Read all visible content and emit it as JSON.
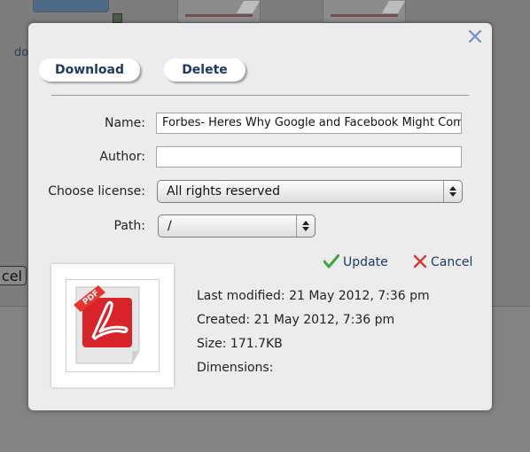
{
  "background": {
    "partial_text": "do",
    "partial_button": "cel"
  },
  "dialog": {
    "buttons": {
      "download": "Download",
      "delete": "Delete"
    },
    "form": {
      "name_label": "Name:",
      "name_value": "Forbes- Heres Why Google and Facebook Might Comp",
      "author_label": "Author:",
      "author_value": "",
      "license_label": "Choose license:",
      "license_value": "All rights reserved",
      "path_label": "Path:",
      "path_value": "/"
    },
    "actions": {
      "update": "Update",
      "cancel": "Cancel"
    },
    "file_icon_badge": "PDF",
    "meta": {
      "last_modified": "Last modified: 21 May 2012, 7:36 pm",
      "created": "Created: 21 May 2012, 7:36 pm",
      "size": "Size: 171.7KB",
      "dimensions": "Dimensions:"
    }
  },
  "colors": {
    "link": "#1f3a62",
    "update_check": "#3aa53a",
    "cancel_x": "#d23a3a",
    "pdf_red": "#d8232a"
  },
  "icons": [
    "close-icon",
    "checkmark-icon",
    "cross-icon",
    "pdf-file-icon"
  ]
}
